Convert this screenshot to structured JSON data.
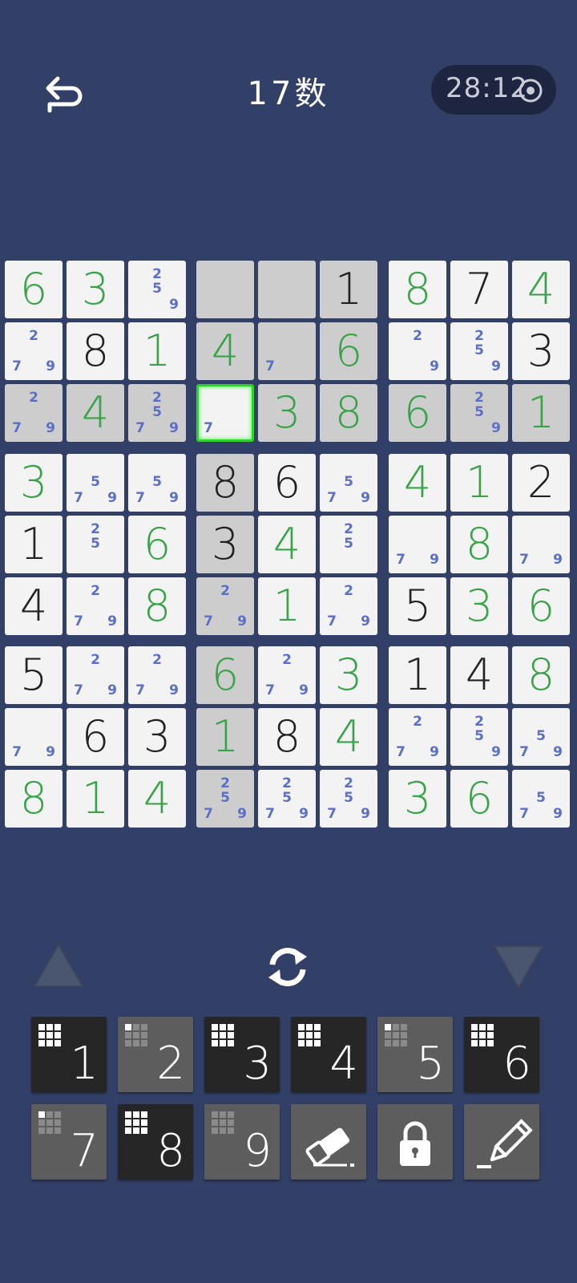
{
  "header": {
    "title": "17数",
    "timer": "28:12"
  },
  "colors": {
    "background": "#323f66",
    "cell": "#f3f3f3",
    "cell_highlight": "#cdcdcd",
    "given_digit": "#222222",
    "entered_digit": "#3aa34a",
    "note_digit": "#5b6fc4",
    "selected_border": "#2ed12e"
  },
  "board": {
    "selected": [
      2,
      3
    ],
    "cells": [
      [
        {
          "v": "6",
          "t": "user"
        },
        {
          "v": "3",
          "t": "user"
        },
        {
          "n": [
            2,
            5,
            9
          ]
        },
        {
          "n": [],
          "h": 1
        },
        {
          "n": [],
          "h": 1
        },
        {
          "v": "1",
          "t": "given",
          "h": 1
        },
        {
          "v": "8",
          "t": "user"
        },
        {
          "v": "7",
          "t": "given"
        },
        {
          "v": "4",
          "t": "user"
        }
      ],
      [
        {
          "n": [
            2,
            7,
            9
          ]
        },
        {
          "v": "8",
          "t": "given"
        },
        {
          "v": "1",
          "t": "user"
        },
        {
          "v": "4",
          "t": "user",
          "h": 1
        },
        {
          "n": [
            7
          ],
          "h": 1
        },
        {
          "v": "6",
          "t": "user",
          "h": 1
        },
        {
          "n": [
            2,
            9
          ]
        },
        {
          "n": [
            2,
            5,
            9
          ]
        },
        {
          "v": "3",
          "t": "given"
        }
      ],
      [
        {
          "n": [
            2,
            7,
            9
          ],
          "h": 1
        },
        {
          "v": "4",
          "t": "user",
          "h": 1
        },
        {
          "n": [
            2,
            5,
            7,
            9
          ],
          "h": 1
        },
        {
          "n": [
            7
          ]
        },
        {
          "v": "3",
          "t": "user",
          "h": 1
        },
        {
          "v": "8",
          "t": "user",
          "h": 1
        },
        {
          "v": "6",
          "t": "user",
          "h": 1
        },
        {
          "n": [
            2,
            5,
            9
          ],
          "h": 1
        },
        {
          "v": "1",
          "t": "user",
          "h": 1
        }
      ],
      [
        {
          "v": "3",
          "t": "user"
        },
        {
          "n": [
            5,
            7,
            9
          ]
        },
        {
          "n": [
            5,
            7,
            9
          ]
        },
        {
          "v": "8",
          "t": "given",
          "h": 1
        },
        {
          "v": "6",
          "t": "given"
        },
        {
          "n": [
            5,
            7,
            9
          ]
        },
        {
          "v": "4",
          "t": "user"
        },
        {
          "v": "1",
          "t": "user"
        },
        {
          "v": "2",
          "t": "given"
        }
      ],
      [
        {
          "v": "1",
          "t": "given"
        },
        {
          "n": [
            2,
            5
          ]
        },
        {
          "v": "6",
          "t": "user"
        },
        {
          "v": "3",
          "t": "given",
          "h": 1
        },
        {
          "v": "4",
          "t": "user"
        },
        {
          "n": [
            2,
            5
          ]
        },
        {
          "n": [
            7,
            9
          ]
        },
        {
          "v": "8",
          "t": "user"
        },
        {
          "n": [
            7,
            9
          ]
        }
      ],
      [
        {
          "v": "4",
          "t": "given"
        },
        {
          "n": [
            2,
            7,
            9
          ]
        },
        {
          "v": "8",
          "t": "user"
        },
        {
          "n": [
            2,
            7,
            9
          ],
          "h": 1
        },
        {
          "v": "1",
          "t": "user"
        },
        {
          "n": [
            2,
            7,
            9
          ]
        },
        {
          "v": "5",
          "t": "given"
        },
        {
          "v": "3",
          "t": "user"
        },
        {
          "v": "6",
          "t": "user"
        }
      ],
      [
        {
          "v": "5",
          "t": "given"
        },
        {
          "n": [
            2,
            7,
            9
          ]
        },
        {
          "n": [
            2,
            7,
            9
          ]
        },
        {
          "v": "6",
          "t": "user",
          "h": 1
        },
        {
          "n": [
            2,
            7,
            9
          ]
        },
        {
          "v": "3",
          "t": "user"
        },
        {
          "v": "1",
          "t": "given"
        },
        {
          "v": "4",
          "t": "given"
        },
        {
          "v": "8",
          "t": "user"
        }
      ],
      [
        {
          "n": [
            7,
            9
          ]
        },
        {
          "v": "6",
          "t": "given"
        },
        {
          "v": "3",
          "t": "given"
        },
        {
          "v": "1",
          "t": "user",
          "h": 1
        },
        {
          "v": "8",
          "t": "given"
        },
        {
          "v": "4",
          "t": "user"
        },
        {
          "n": [
            2,
            7,
            9
          ]
        },
        {
          "n": [
            2,
            5,
            9
          ]
        },
        {
          "n": [
            5,
            7,
            9
          ]
        }
      ],
      [
        {
          "v": "8",
          "t": "user"
        },
        {
          "v": "1",
          "t": "user"
        },
        {
          "v": "4",
          "t": "user"
        },
        {
          "n": [
            2,
            5,
            7,
            9
          ],
          "h": 1
        },
        {
          "n": [
            2,
            5,
            7,
            9
          ]
        },
        {
          "n": [
            2,
            5,
            7,
            9
          ]
        },
        {
          "v": "3",
          "t": "user"
        },
        {
          "v": "6",
          "t": "user"
        },
        {
          "n": [
            5,
            7,
            9
          ]
        }
      ]
    ]
  },
  "controls": {
    "prev": "triangle-up-icon",
    "reset": "refresh-icon",
    "next": "triangle-down-icon"
  },
  "keypad": {
    "digits": [
      {
        "label": "1",
        "style": "dark",
        "filled": 9
      },
      {
        "label": "2",
        "style": "gray",
        "filled": 1
      },
      {
        "label": "3",
        "style": "dark",
        "filled": 9
      },
      {
        "label": "4",
        "style": "dark",
        "filled": 9
      },
      {
        "label": "5",
        "style": "gray",
        "filled": 1
      },
      {
        "label": "6",
        "style": "dark",
        "filled": 9
      },
      {
        "label": "7",
        "style": "gray",
        "filled": 1
      },
      {
        "label": "8",
        "style": "dark",
        "filled": 9
      },
      {
        "label": "9",
        "style": "gray",
        "filled": 0
      }
    ],
    "tools": [
      "eraser-icon",
      "lock-icon",
      "pencil-icon"
    ]
  }
}
